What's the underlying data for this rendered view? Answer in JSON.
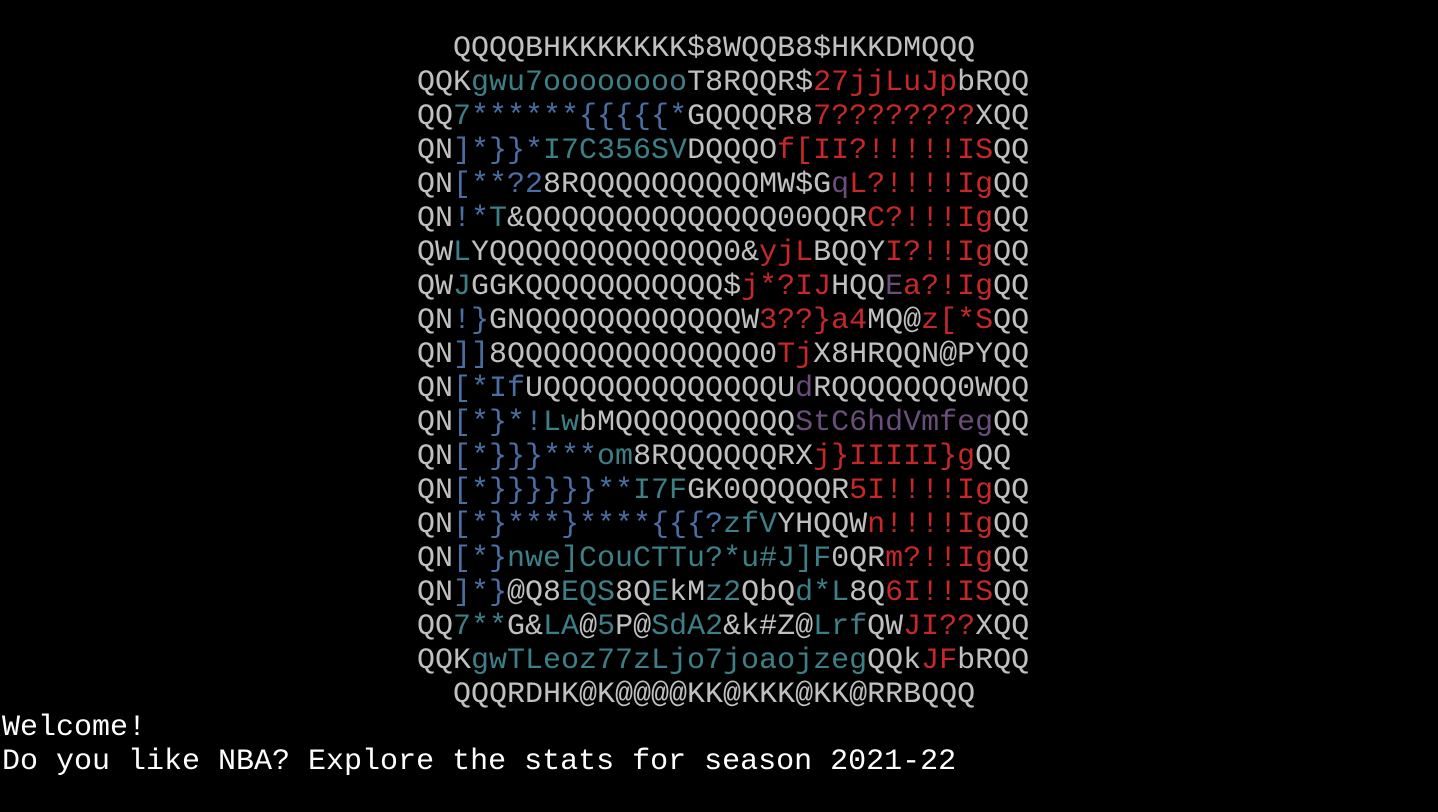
{
  "window": {
    "background": "#000000",
    "default_text_color": "#c0c0c0",
    "message_text_color": "#ffffff"
  },
  "ascii_art": {
    "palette": {
      "w": "#c0c0c0",
      "t": "#3d7f87",
      "b": "#4a6fa5",
      "r": "#c62828",
      "p": "#6a4d7a"
    },
    "lines": [
      {
        "indent": "  ",
        "segments": [
          [
            "w",
            "QQQQBHKKKKKKK$8WQQB8$HKKDMQQQ"
          ]
        ]
      },
      {
        "indent": "",
        "segments": [
          [
            "w",
            "QQK"
          ],
          [
            "t",
            "gwu7oooooooo"
          ],
          [
            "w",
            "T8RQQR$"
          ],
          [
            "r",
            "27jjLuJp"
          ],
          [
            "w",
            "bRQQ"
          ]
        ]
      },
      {
        "indent": "",
        "segments": [
          [
            "w",
            "QQ"
          ],
          [
            "t",
            "7"
          ],
          [
            "b",
            "******{{{{{*"
          ],
          [
            "w",
            "GQQQQR8"
          ],
          [
            "r",
            "7????????"
          ],
          [
            "w",
            "XQQ"
          ]
        ]
      },
      {
        "indent": "",
        "segments": [
          [
            "w",
            "QN"
          ],
          [
            "b",
            "]*}}*"
          ],
          [
            "t",
            "I7C356SV"
          ],
          [
            "w",
            "DQQQO"
          ],
          [
            "r",
            "f[II?!!!!!IS"
          ],
          [
            "w",
            "QQ"
          ]
        ]
      },
      {
        "indent": "",
        "segments": [
          [
            "w",
            "QN"
          ],
          [
            "b",
            "[**?2"
          ],
          [
            "w",
            "8RQQQQQQQQQQMW$G"
          ],
          [
            "p",
            "q"
          ],
          [
            "r",
            "L?!!!!Ig"
          ],
          [
            "w",
            "QQ"
          ]
        ]
      },
      {
        "indent": "",
        "segments": [
          [
            "w",
            "QN"
          ],
          [
            "b",
            "!*"
          ],
          [
            "t",
            "T"
          ],
          [
            "w",
            "&QQQQQQQQQQQQQQ00QQR"
          ],
          [
            "r",
            "C?!!!Ig"
          ],
          [
            "w",
            "QQ"
          ]
        ]
      },
      {
        "indent": "",
        "segments": [
          [
            "w",
            "QW"
          ],
          [
            "t",
            "L"
          ],
          [
            "w",
            "YQQQQQQQQQQQQQ0&"
          ],
          [
            "r",
            "yjL"
          ],
          [
            "w",
            "BQQY"
          ],
          [
            "r",
            "I?!!Ig"
          ],
          [
            "w",
            "QQ"
          ]
        ]
      },
      {
        "indent": "",
        "segments": [
          [
            "w",
            "QW"
          ],
          [
            "t",
            "J"
          ],
          [
            "w",
            "GGKQQQQQQQQQQQ$"
          ],
          [
            "r",
            "j*?IJ"
          ],
          [
            "w",
            "HQQ"
          ],
          [
            "p",
            "E"
          ],
          [
            "r",
            "a?!Ig"
          ],
          [
            "w",
            "QQ"
          ]
        ]
      },
      {
        "indent": "",
        "segments": [
          [
            "w",
            "QN"
          ],
          [
            "b",
            "!}"
          ],
          [
            "w",
            "GNQQQQQQQQQQQQW"
          ],
          [
            "r",
            "3??}a4"
          ],
          [
            "w",
            "MQ@"
          ],
          [
            "r",
            "z[*S"
          ],
          [
            "w",
            "QQ"
          ]
        ]
      },
      {
        "indent": "",
        "segments": [
          [
            "w",
            "QN"
          ],
          [
            "b",
            "]]"
          ],
          [
            "w",
            "8QQQQQQQQQQQQQQ0"
          ],
          [
            "r",
            "Tj"
          ],
          [
            "w",
            "X8HRQQN@PYQQ"
          ]
        ]
      },
      {
        "indent": "",
        "segments": [
          [
            "w",
            "QN"
          ],
          [
            "b",
            "[*If"
          ],
          [
            "w",
            "UQQQQQQQQQQQQQU"
          ],
          [
            "p",
            "d"
          ],
          [
            "w",
            "RQQQQQQQ0WQQ"
          ]
        ]
      },
      {
        "indent": "",
        "segments": [
          [
            "w",
            "QN"
          ],
          [
            "b",
            "[*}*!"
          ],
          [
            "t",
            "Lw"
          ],
          [
            "w",
            "bMQQQQQQQQQQ"
          ],
          [
            "p",
            "StC6hdVmfeg"
          ],
          [
            "w",
            "QQ"
          ]
        ]
      },
      {
        "indent": "",
        "segments": [
          [
            "w",
            "QN"
          ],
          [
            "b",
            "[*}}}***"
          ],
          [
            "t",
            "om"
          ],
          [
            "w",
            "8RQQQQQQRX"
          ],
          [
            "r",
            "j}IIIII}g"
          ],
          [
            "w",
            "QQ"
          ]
        ]
      },
      {
        "indent": "",
        "segments": [
          [
            "w",
            "QN"
          ],
          [
            "b",
            "[*}}}}}}**"
          ],
          [
            "t",
            "I7F"
          ],
          [
            "w",
            "GK0QQQQQR"
          ],
          [
            "r",
            "5I!!!!Ig"
          ],
          [
            "w",
            "QQ"
          ]
        ]
      },
      {
        "indent": "",
        "segments": [
          [
            "w",
            "QN"
          ],
          [
            "b",
            "[*}***}****{{{?"
          ],
          [
            "t",
            "zfV"
          ],
          [
            "w",
            "YHQQW"
          ],
          [
            "r",
            "n!!!!Ig"
          ],
          [
            "w",
            "QQ"
          ]
        ]
      },
      {
        "indent": "",
        "segments": [
          [
            "w",
            "QN"
          ],
          [
            "b",
            "[*}"
          ],
          [
            "t",
            "nwe]CouCTTu?*u#J]F"
          ],
          [
            "w",
            "0QR"
          ],
          [
            "r",
            "m?!!Ig"
          ],
          [
            "w",
            "QQ"
          ]
        ]
      },
      {
        "indent": "",
        "segments": [
          [
            "w",
            "QN"
          ],
          [
            "b",
            "]*}"
          ],
          [
            "w",
            "@Q8"
          ],
          [
            "t",
            "EQS"
          ],
          [
            "w",
            "8Q"
          ],
          [
            "t",
            "E"
          ],
          [
            "w",
            "kM"
          ],
          [
            "t",
            "z2"
          ],
          [
            "w",
            "QbQ"
          ],
          [
            "t",
            "d*L"
          ],
          [
            "w",
            "8Q"
          ],
          [
            "r",
            "6I!!IS"
          ],
          [
            "w",
            "QQ"
          ]
        ]
      },
      {
        "indent": "",
        "segments": [
          [
            "w",
            "QQ"
          ],
          [
            "t",
            "7**"
          ],
          [
            "w",
            "G&"
          ],
          [
            "t",
            "LA"
          ],
          [
            "w",
            "@"
          ],
          [
            "t",
            "5"
          ],
          [
            "w",
            "P@"
          ],
          [
            "t",
            "SdA2"
          ],
          [
            "w",
            "&k#Z@"
          ],
          [
            "t",
            "Lrf"
          ],
          [
            "w",
            "QW"
          ],
          [
            "r",
            "JI??"
          ],
          [
            "w",
            "XQQ"
          ]
        ]
      },
      {
        "indent": "",
        "segments": [
          [
            "w",
            "QQK"
          ],
          [
            "t",
            "gwTLeoz77zLjo7joaojzeg"
          ],
          [
            "w",
            "QQk"
          ],
          [
            "r",
            "JF"
          ],
          [
            "w",
            "bRQQ"
          ]
        ]
      },
      {
        "indent": "  ",
        "segments": [
          [
            "w",
            "QQQRDHK@K@@@@KK@KKK@KK@RRBQQQ"
          ]
        ]
      }
    ]
  },
  "messages": {
    "welcome": "Welcome!",
    "prompt": "Do you like NBA? Explore the stats for season 2021-22"
  }
}
